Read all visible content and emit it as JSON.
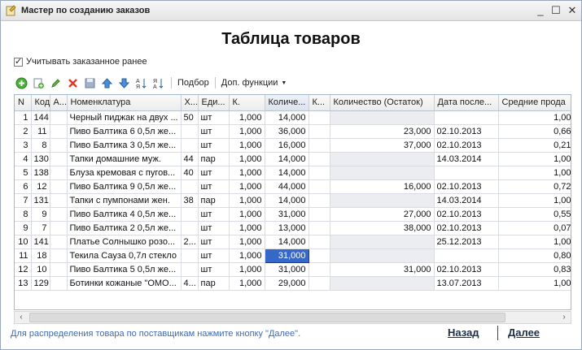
{
  "window": {
    "title": "Мастер по созданию заказов",
    "buttons": {
      "minimize": "_",
      "maximize": "☐",
      "close": "✕"
    }
  },
  "page": {
    "title": "Таблица товаров"
  },
  "options": {
    "use_ordered_label": "Учитывать заказанное ранее",
    "use_ordered_checked": true
  },
  "toolbar": {
    "icons": [
      "add-icon",
      "copy-icon",
      "edit-icon",
      "delete-icon",
      "save-icon",
      "move-up-icon",
      "move-down-icon",
      "sort-asc-icon",
      "sort-desc-icon"
    ],
    "select_label": "Подбор",
    "more_label": "Доп. функции"
  },
  "table": {
    "columns": [
      "N",
      "Код",
      "А...",
      "Номенклатура",
      "Х...",
      "Еди...",
      "К.",
      "Количе...",
      "К...",
      "Количество (Остаток)",
      "Дата после...",
      "Средние прода"
    ],
    "rows": [
      [
        "1",
        "144",
        "",
        "Черный пиджак на двух ...",
        "50",
        "шт",
        "1,000",
        "14,000",
        "",
        "",
        "",
        "1,00"
      ],
      [
        "2",
        "11",
        "",
        "Пиво Балтика 6 0,5л же...",
        "",
        "шт",
        "1,000",
        "36,000",
        "",
        "23,000",
        "02.10.2013",
        "0,66"
      ],
      [
        "3",
        "8",
        "",
        "Пиво Балтика 3 0,5л же...",
        "",
        "шт",
        "1,000",
        "16,000",
        "",
        "37,000",
        "02.10.2013",
        "0,21"
      ],
      [
        "4",
        "130",
        "",
        "Тапки домашние муж.",
        "44",
        "пар",
        "1,000",
        "14,000",
        "",
        "",
        "14.03.2014",
        "1,00"
      ],
      [
        "5",
        "138",
        "",
        "Блуза кремовая с пугов...",
        "40",
        "шт",
        "1,000",
        "14,000",
        "",
        "",
        "",
        "1,00"
      ],
      [
        "6",
        "12",
        "",
        "Пиво Балтика 9 0,5л же...",
        "",
        "шт",
        "1,000",
        "44,000",
        "",
        "16,000",
        "02.10.2013",
        "0,72"
      ],
      [
        "7",
        "131",
        "",
        "Тапки с пумпонами жен.",
        "38",
        "пар",
        "1,000",
        "14,000",
        "",
        "",
        "14.03.2014",
        "1,00"
      ],
      [
        "8",
        "9",
        "",
        "Пиво Балтика 4 0,5л же...",
        "",
        "шт",
        "1,000",
        "31,000",
        "",
        "27,000",
        "02.10.2013",
        "0,55"
      ],
      [
        "9",
        "7",
        "",
        "Пиво Балтика 2 0,5л же...",
        "",
        "шт",
        "1,000",
        "13,000",
        "",
        "38,000",
        "02.10.2013",
        "0,07"
      ],
      [
        "10",
        "141",
        "",
        "Платье Солнышко розо...",
        "2...",
        "шт",
        "1,000",
        "14,000",
        "",
        "",
        "25.12.2013",
        "1,00"
      ],
      [
        "11",
        "18",
        "",
        "Текила Сауза 0,7л стекло",
        "",
        "шт",
        "1,000",
        "31,000",
        "",
        "",
        "",
        "0,80"
      ],
      [
        "12",
        "10",
        "",
        "Пиво Балтика 5 0,5л же...",
        "",
        "шт",
        "1,000",
        "31,000",
        "",
        "31,000",
        "02.10.2013",
        "0,83"
      ],
      [
        "13",
        "129",
        "",
        "Ботинки кожаные \"ОМО...",
        "4...",
        "пар",
        "1,000",
        "29,000",
        "",
        "",
        "13.07.2013",
        "1,00"
      ]
    ]
  },
  "footer": {
    "hint": "Для распределения товара по поставщикам нажмите кнопку \"Далее\".",
    "back_label": "Назад",
    "next_label": "Далее"
  }
}
